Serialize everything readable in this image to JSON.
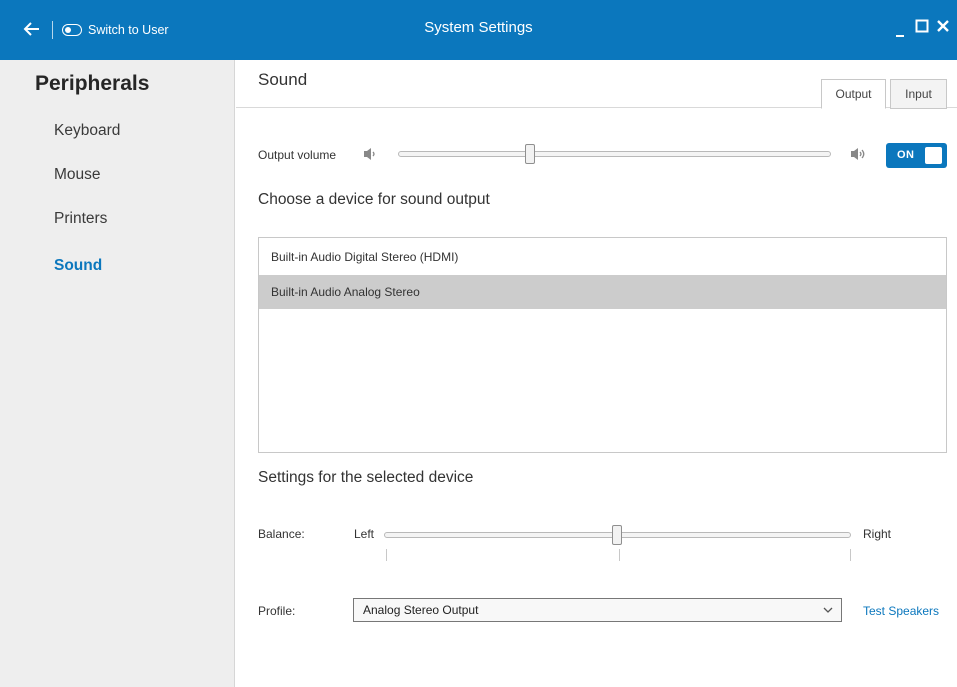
{
  "window": {
    "title": "System Settings",
    "switch_label": "Switch to User"
  },
  "sidebar": {
    "heading": "Peripherals",
    "items": [
      {
        "label": "Keyboard",
        "active": false
      },
      {
        "label": "Mouse",
        "active": false
      },
      {
        "label": "Printers",
        "active": false
      },
      {
        "label": "Sound",
        "active": true
      }
    ]
  },
  "main": {
    "title": "Sound",
    "tabs": [
      {
        "label": "Output",
        "active": true
      },
      {
        "label": "Input",
        "active": false
      }
    ],
    "output_volume": {
      "label": "Output volume",
      "level": 0.3,
      "toggle_label": "ON"
    },
    "device_section_heading": "Choose a device for sound output",
    "devices": [
      {
        "name": "Built-in Audio Digital Stereo (HDMI)",
        "selected": false
      },
      {
        "name": "Built-in Audio Analog Stereo",
        "selected": true
      }
    ],
    "settings_heading": "Settings for the selected device",
    "balance": {
      "label": "Balance:",
      "left_label": "Left",
      "right_label": "Right",
      "value": 0.5
    },
    "profile": {
      "label": "Profile:",
      "selected": "Analog Stereo Output"
    },
    "test_speakers_label": "Test Speakers"
  },
  "colors": {
    "accent": "#0b77bd",
    "sidebar_bg": "#eeeeee",
    "selected_row": "#cccccc"
  }
}
